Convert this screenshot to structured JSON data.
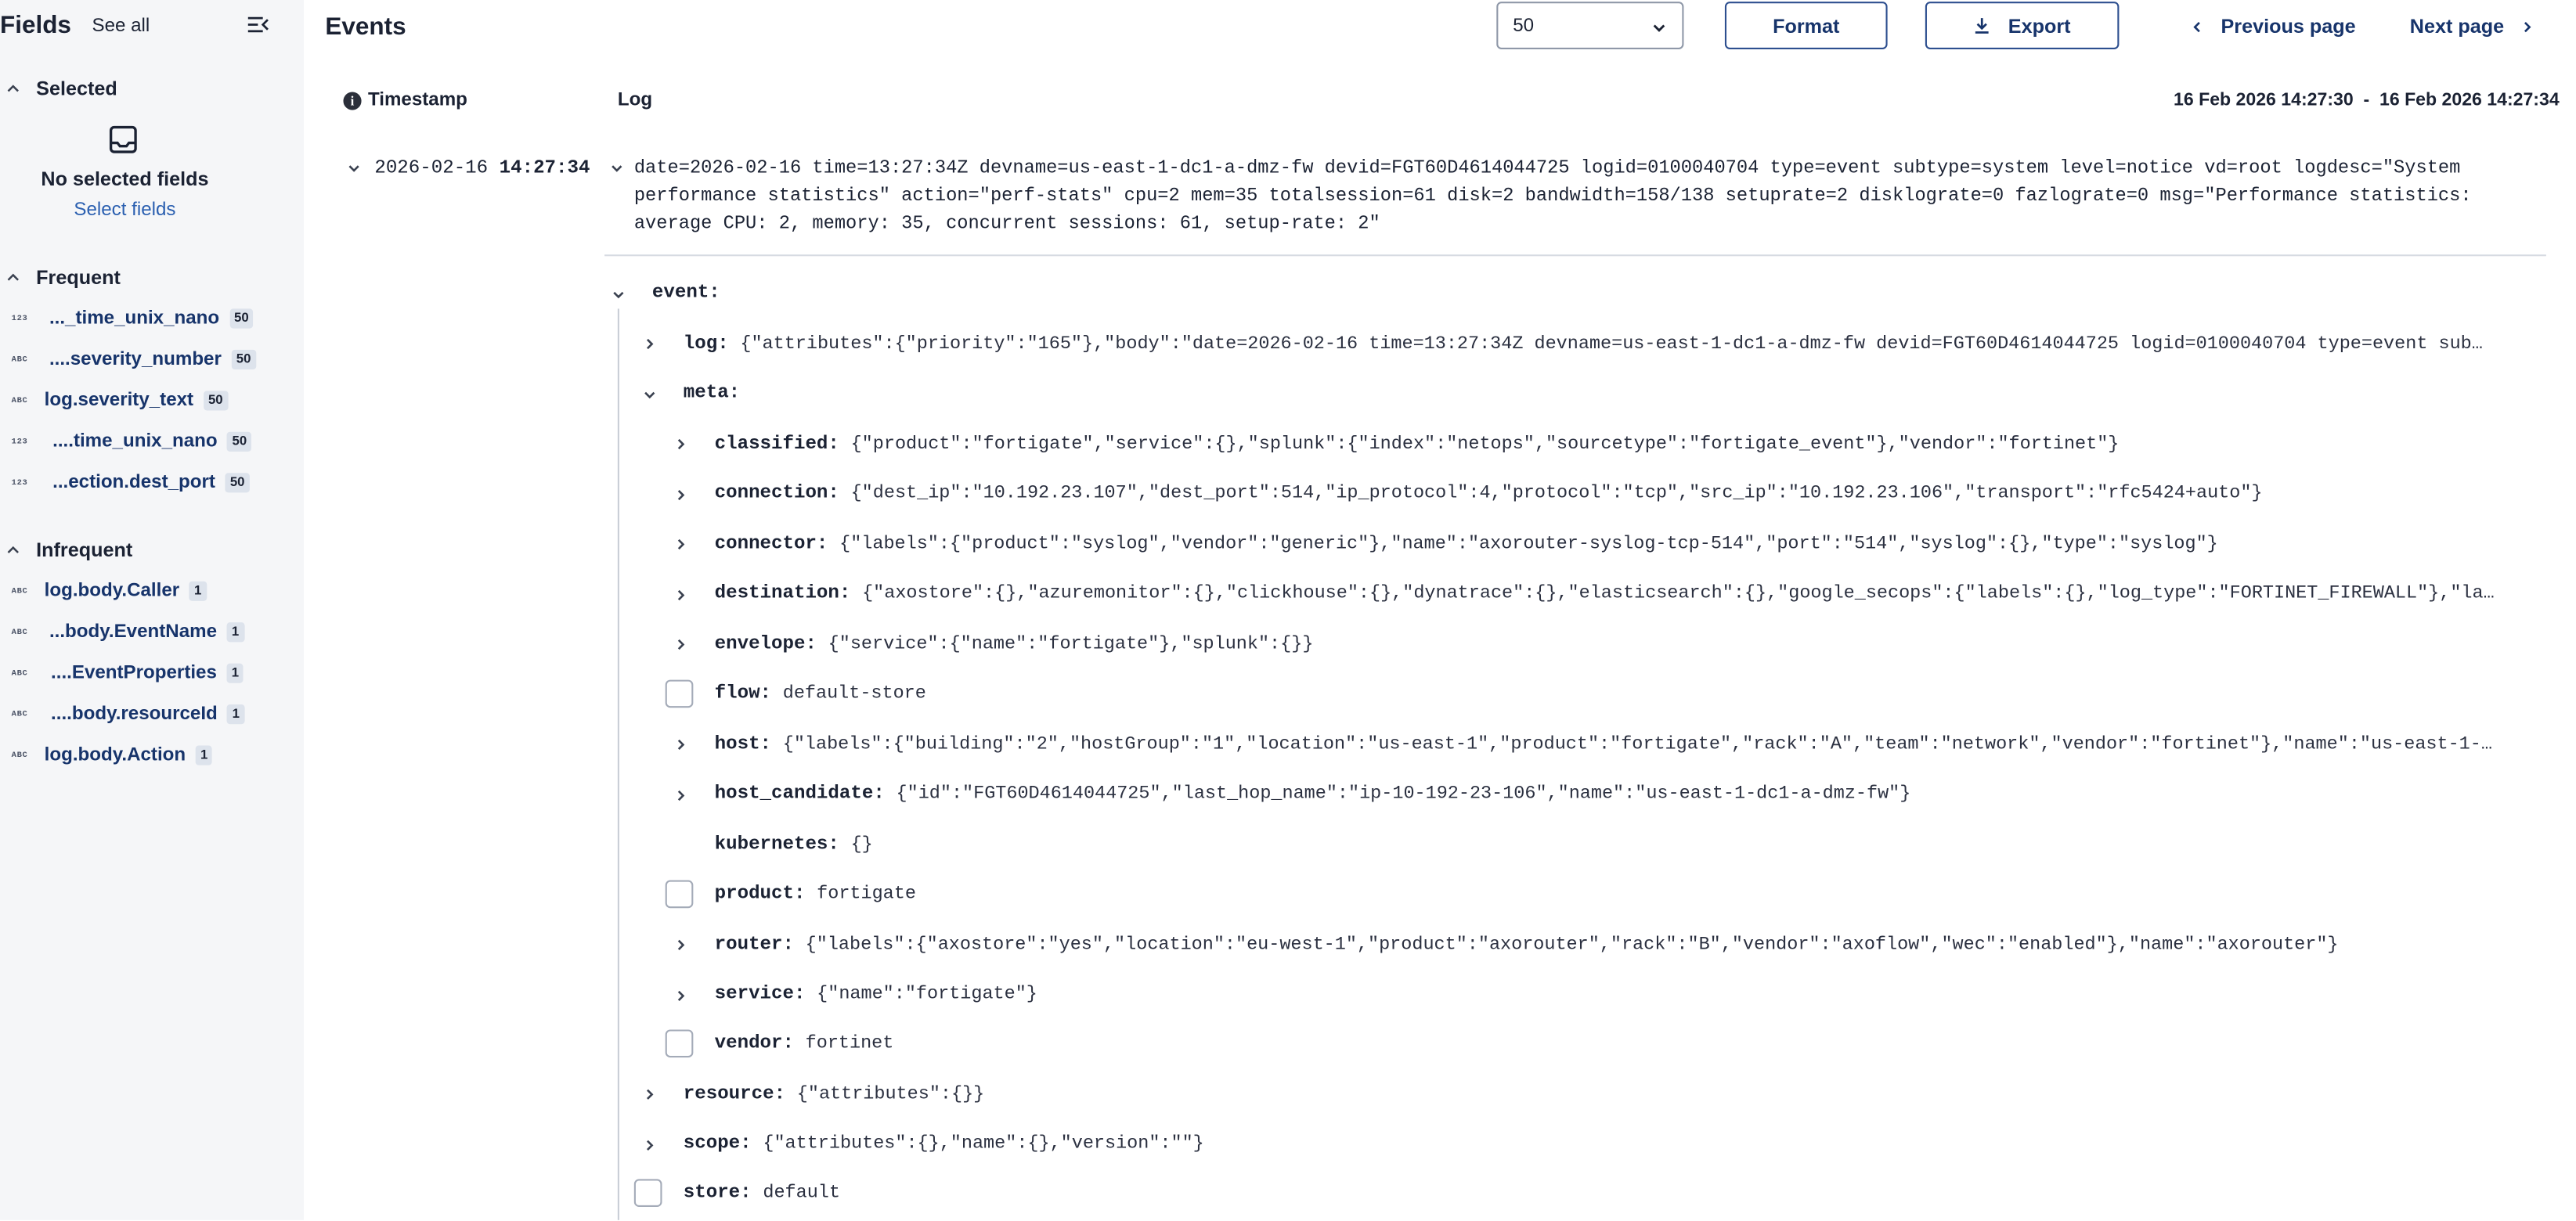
{
  "sidebar": {
    "title": "Fields",
    "see_all": "See all",
    "selected": {
      "title": "Selected",
      "empty_text": "No selected fields",
      "select_link": "Select fields"
    },
    "frequent": {
      "title": "Frequent",
      "items": [
        {
          "type": "123",
          "name": "..._time_unix_nano",
          "count": "50"
        },
        {
          "type": "ABC",
          "name": "....severity_number",
          "count": "50"
        },
        {
          "type": "ABC",
          "name": "log.severity_text",
          "count": "50"
        },
        {
          "type": "123",
          "name": "....time_unix_nano",
          "count": "50"
        },
        {
          "type": "123",
          "name": "...ection.dest_port",
          "count": "50"
        }
      ]
    },
    "infrequent": {
      "title": "Infrequent",
      "items": [
        {
          "type": "ABC",
          "name": "log.body.Caller",
          "count": "1"
        },
        {
          "type": "ABC",
          "name": "...body.EventName",
          "count": "1"
        },
        {
          "type": "ABC",
          "name": "....EventProperties",
          "count": "1"
        },
        {
          "type": "ABC",
          "name": "....body.resourceId",
          "count": "1"
        },
        {
          "type": "ABC",
          "name": "log.body.Action",
          "count": "1"
        }
      ]
    }
  },
  "header": {
    "title": "Events",
    "page_size": "50",
    "format_label": "Format",
    "export_label": "Export",
    "prev_label": "Previous page",
    "next_label": "Next page"
  },
  "columns": {
    "timestamp": "Timestamp",
    "log": "Log",
    "range": "16 Feb 2026 14:27:30  -  16 Feb 2026 14:27:34"
  },
  "event": {
    "date": "2026-02-16",
    "time": "14:27:34",
    "log_text": "date=2026-02-16 time=13:27:34Z devname=us-east-1-dc1-a-dmz-fw devid=FGT60D4614044725 logid=0100040704 type=event subtype=system level=notice vd=root logdesc=\"System performance statistics\" action=\"perf-stats\" cpu=2 mem=35 totalsession=61 disk=2 bandwidth=158/138 setuprate=2 disklograte=0 fazlograte=0 msg=\"Performance statistics: average CPU: 2, memory:  35, concurrent sessions:  61, setup-rate: 2\""
  },
  "tree": {
    "event": {
      "key": "event:"
    },
    "log": {
      "key": "log:",
      "value": "{\"attributes\":{\"priority\":\"165\"},\"body\":\"date=2026-02-16 time=13:27:34Z devname=us-east-1-dc1-a-dmz-fw devid=FGT60D4614044725 logid=0100040704 type=event sub…"
    },
    "meta": {
      "key": "meta:"
    },
    "classified": {
      "key": "classified:",
      "value": "{\"product\":\"fortigate\",\"service\":{},\"splunk\":{\"index\":\"netops\",\"sourcetype\":\"fortigate_event\"},\"vendor\":\"fortinet\"}"
    },
    "connection": {
      "key": "connection:",
      "value": "{\"dest_ip\":\"10.192.23.107\",\"dest_port\":514,\"ip_protocol\":4,\"protocol\":\"tcp\",\"src_ip\":\"10.192.23.106\",\"transport\":\"rfc5424+auto\"}"
    },
    "connector": {
      "key": "connector:",
      "value": "{\"labels\":{\"product\":\"syslog\",\"vendor\":\"generic\"},\"name\":\"axorouter-syslog-tcp-514\",\"port\":\"514\",\"syslog\":{},\"type\":\"syslog\"}"
    },
    "destination": {
      "key": "destination:",
      "value": "{\"axostore\":{},\"azuremonitor\":{},\"clickhouse\":{},\"dynatrace\":{},\"elasticsearch\":{},\"google_secops\":{\"labels\":{},\"log_type\":\"FORTINET_FIREWALL\"},\"la…"
    },
    "envelope": {
      "key": "envelope:",
      "value": "{\"service\":{\"name\":\"fortigate\"},\"splunk\":{}}"
    },
    "flow": {
      "key": "flow:",
      "value": "default-store"
    },
    "host": {
      "key": "host:",
      "value": "{\"labels\":{\"building\":\"2\",\"hostGroup\":\"1\",\"location\":\"us-east-1\",\"product\":\"fortigate\",\"rack\":\"A\",\"team\":\"network\",\"vendor\":\"fortinet\"},\"name\":\"us-east-1-…"
    },
    "host_candidate": {
      "key": "host_candidate:",
      "value": "{\"id\":\"FGT60D4614044725\",\"last_hop_name\":\"ip-10-192-23-106\",\"name\":\"us-east-1-dc1-a-dmz-fw\"}"
    },
    "kubernetes": {
      "key": "kubernetes:",
      "value": "{}"
    },
    "product": {
      "key": "product:",
      "value": "fortigate"
    },
    "router": {
      "key": "router:",
      "value": "{\"labels\":{\"axostore\":\"yes\",\"location\":\"eu-west-1\",\"product\":\"axorouter\",\"rack\":\"B\",\"vendor\":\"axoflow\",\"wec\":\"enabled\"},\"name\":\"axorouter\"}"
    },
    "service": {
      "key": "service:",
      "value": "{\"name\":\"fortigate\"}"
    },
    "vendor": {
      "key": "vendor:",
      "value": "fortinet"
    },
    "resource": {
      "key": "resource:",
      "value": "{\"attributes\":{}}"
    },
    "scope": {
      "key": "scope:",
      "value": "{\"attributes\":{},\"name\":{},\"version\":\"\"}"
    },
    "store": {
      "key": "store:",
      "value": "default"
    }
  },
  "colors": {
    "accent": "#17346b",
    "link": "#2a5fb0",
    "sidebar_bg": "#f5f6f8"
  }
}
